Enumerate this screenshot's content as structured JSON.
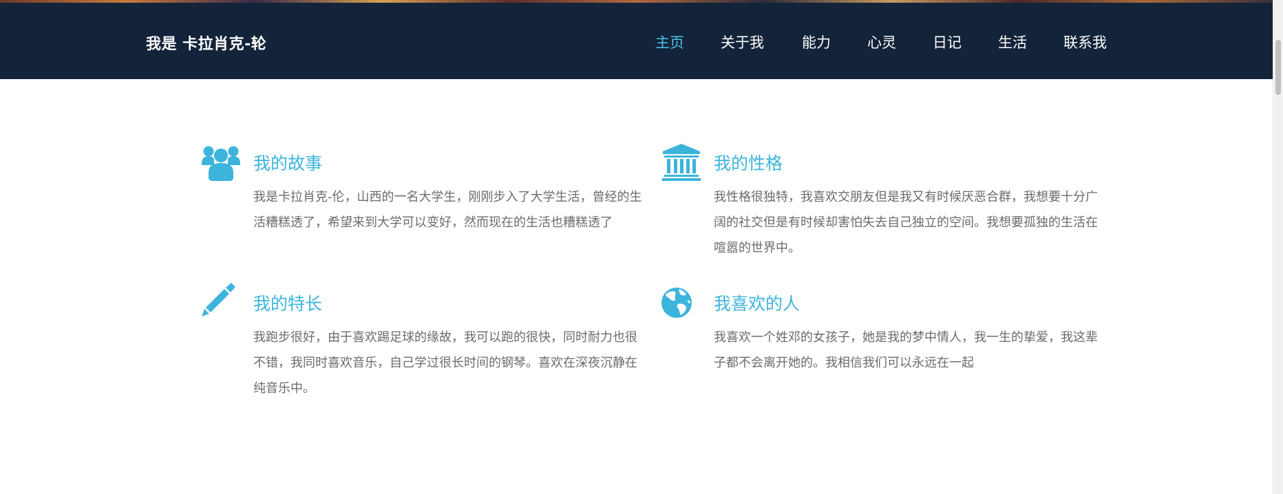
{
  "site": {
    "brand": "我是 卡拉肖克-轮"
  },
  "nav": {
    "items": [
      {
        "label": "主页",
        "active": true
      },
      {
        "label": "关于我",
        "active": false
      },
      {
        "label": "能力",
        "active": false
      },
      {
        "label": "心灵",
        "active": false
      },
      {
        "label": "日记",
        "active": false
      },
      {
        "label": "生活",
        "active": false
      },
      {
        "label": "联系我",
        "active": false
      }
    ]
  },
  "features": [
    {
      "icon": "users-icon",
      "title": "我的故事",
      "desc": "我是卡拉肖克-伦，山西的一名大学生，刚刚步入了大学生活，曾经的生活糟糕透了，希望来到大学可以变好，然而现在的生活也糟糕透了"
    },
    {
      "icon": "bank-icon",
      "title": "我的性格",
      "desc": "我性格很独特，我喜欢交朋友但是我又有时候厌恶合群，我想要十分广阔的社交但是有时候却害怕失去自己独立的空间。我想要孤独的生活在喧嚣的世界中。"
    },
    {
      "icon": "pencil-icon",
      "title": "我的特长",
      "desc": "我跑步很好，由于喜欢踢足球的缘故，我可以跑的很快，同时耐力也很不错，我同时喜欢音乐，自己学过很长时间的钢琴。喜欢在深夜沉静在纯音乐中。"
    },
    {
      "icon": "globe-icon",
      "title": "我喜欢的人",
      "desc": "我喜欢一个姓邓的女孩子，她是我的梦中情人，我一生的挚爱，我这辈子都不会离开她的。我相信我们可以永远在一起"
    }
  ],
  "colors": {
    "navbar_bg": "#13233a",
    "accent": "#3cb4dc",
    "body_text": "#6b6b6b"
  }
}
